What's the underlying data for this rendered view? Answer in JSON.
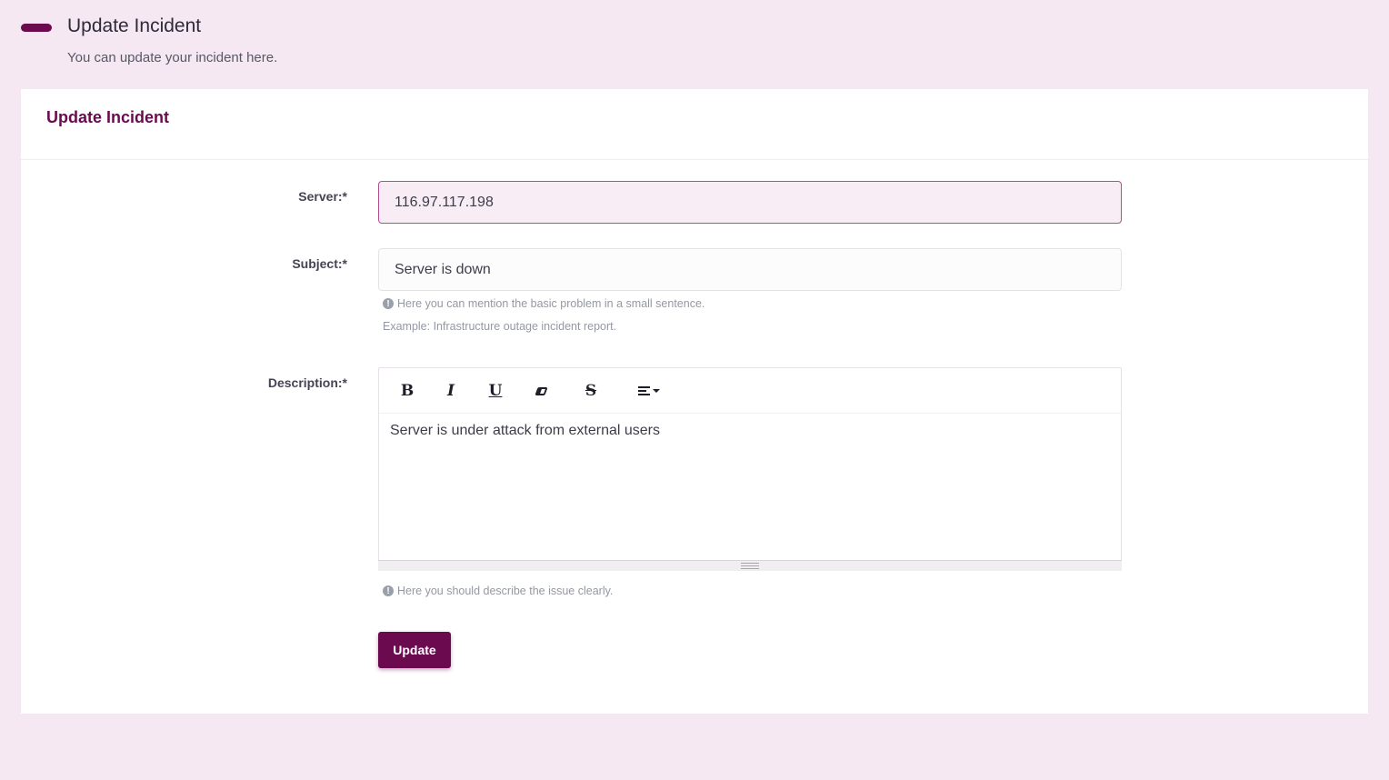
{
  "header": {
    "title": "Update Incident",
    "subtitle": "You can update your incident here."
  },
  "card": {
    "title": "Update Incident"
  },
  "form": {
    "server": {
      "label": "Server:*",
      "value": "116.97.117.198"
    },
    "subject": {
      "label": "Subject:*",
      "value": "Server is down",
      "help": "Here you can mention the basic problem in a small sentence.",
      "example": "Example: Infrastructure outage incident report."
    },
    "description": {
      "label": "Description:*",
      "value": "Server is under attack from external users",
      "help": "Here you should describe the issue clearly."
    },
    "toolbar": {
      "bold": "B",
      "italic": "I",
      "underline": "U",
      "strike": "S",
      "info_glyph": "!"
    },
    "submit_label": "Update"
  },
  "colors": {
    "accent": "#6b0a4f",
    "page_bg": "#f6e8f2"
  }
}
